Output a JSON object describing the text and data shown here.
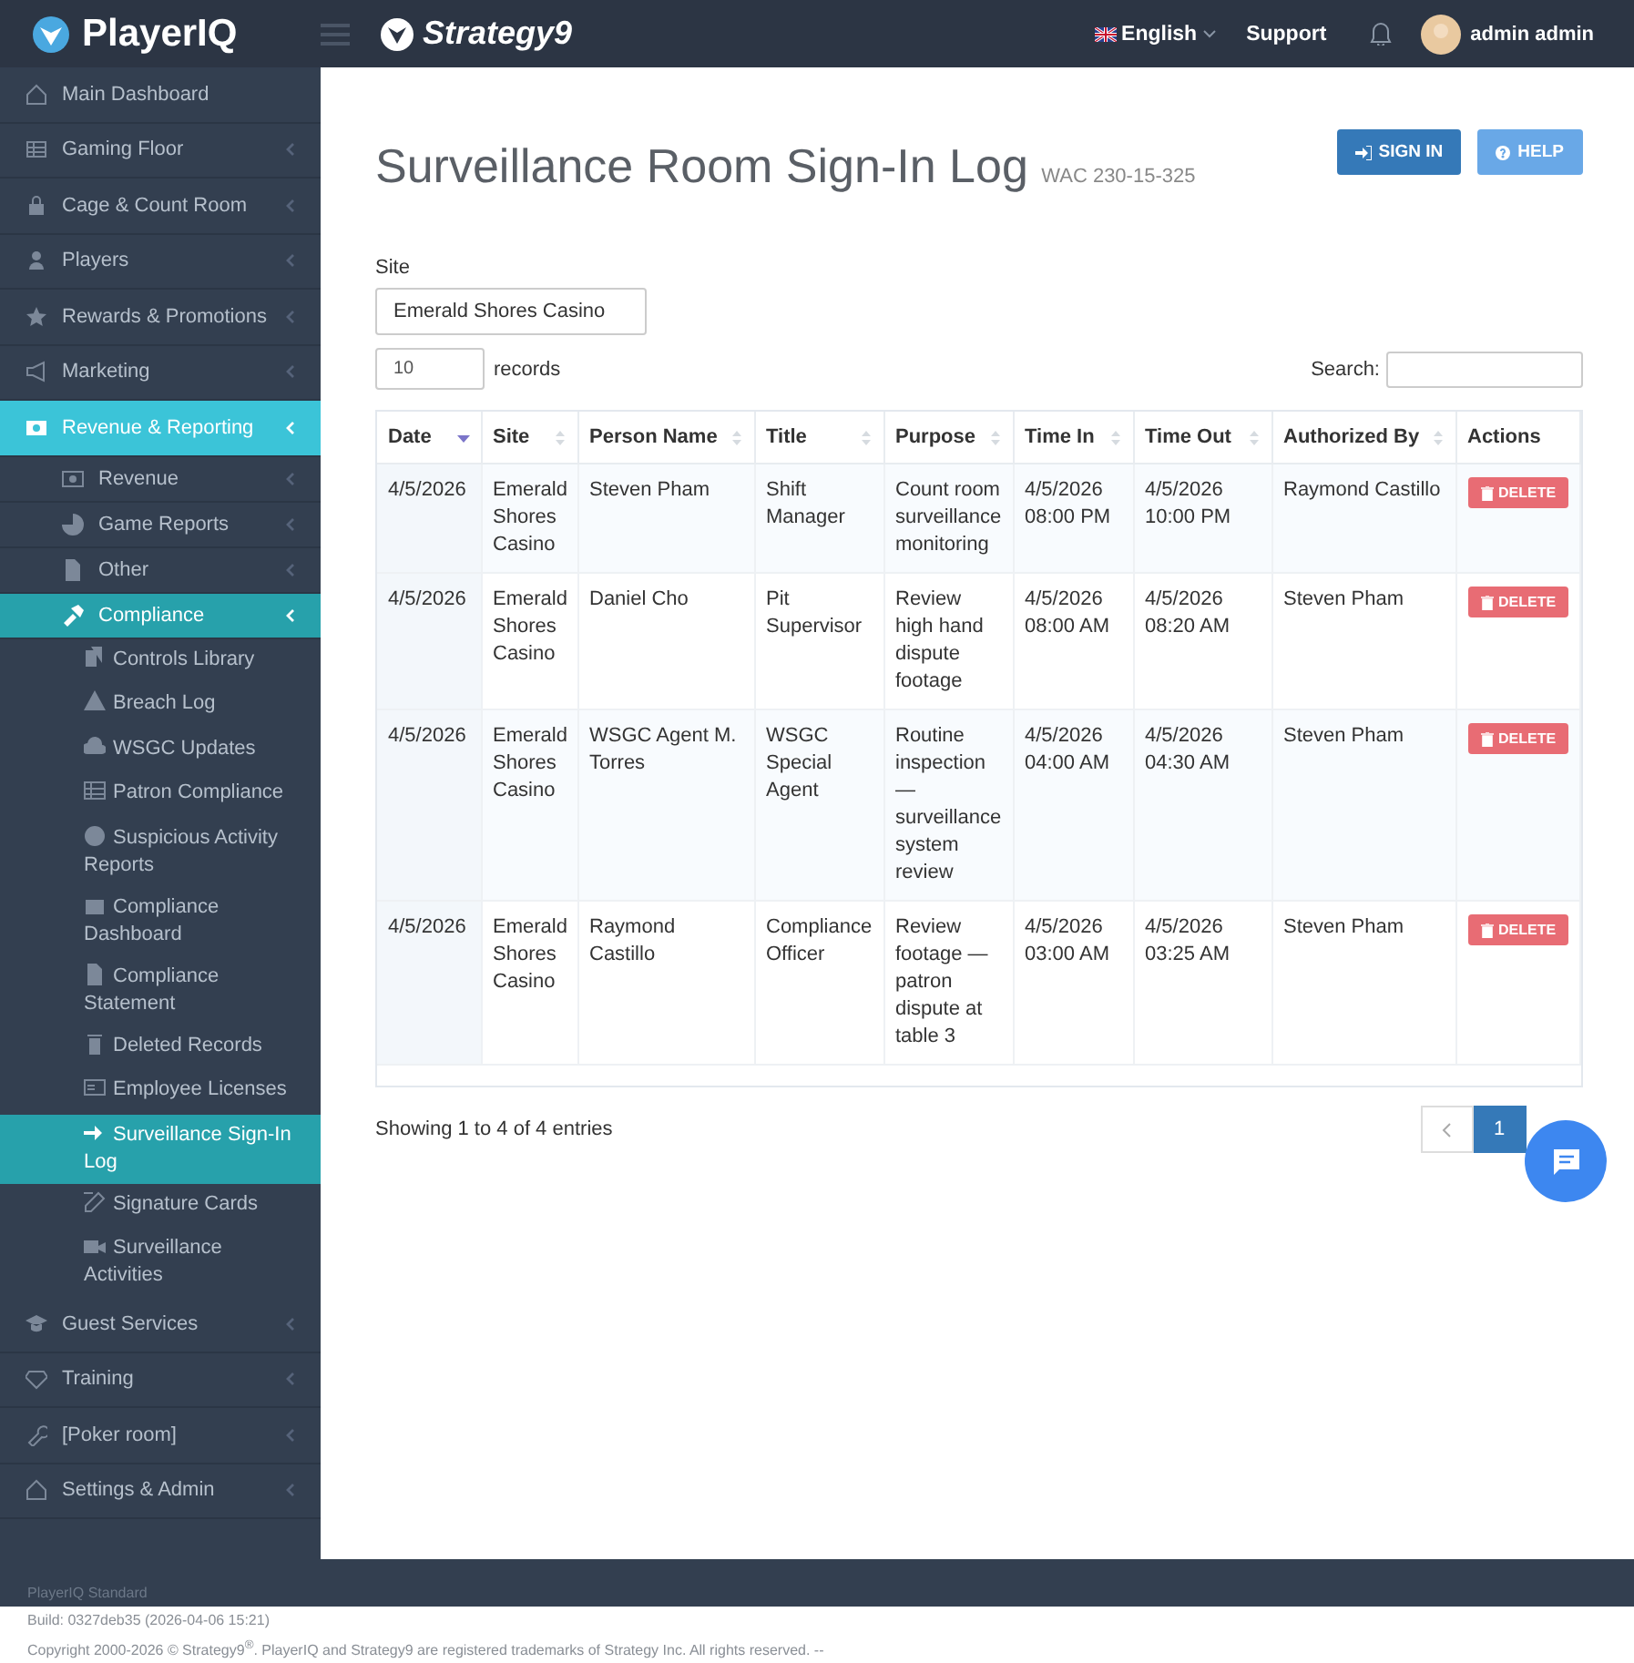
{
  "topbar": {
    "brand": "PlayerIQ",
    "company": "Strategy9",
    "language": "English",
    "support": "Support",
    "user": "admin admin"
  },
  "sidebar": {
    "items": [
      {
        "label": "Main Dashboard",
        "selected": false
      },
      {
        "label": "Gaming Floor",
        "selected": false,
        "expanded": false
      },
      {
        "label": "Cage & Count Room",
        "selected": false,
        "expanded": false
      },
      {
        "label": "Players",
        "selected": false,
        "expanded": false
      },
      {
        "label": "Rewards & Promotions",
        "selected": false,
        "expanded": false
      },
      {
        "label": "Marketing",
        "selected": false,
        "expanded": false
      },
      {
        "label": "Revenue & Reporting",
        "selected": true,
        "expanded": true,
        "children": [
          {
            "label": "Revenue",
            "selected": false,
            "expanded": false
          },
          {
            "label": "Game Reports",
            "selected": false,
            "expanded": false
          },
          {
            "label": "Other",
            "selected": false,
            "expanded": false
          },
          {
            "label": "Compliance",
            "selected": true,
            "expanded": true,
            "children": [
              {
                "label": "Controls Library",
                "selected": false
              },
              {
                "label": "Breach Log",
                "selected": false
              },
              {
                "label": "WSGC Updates",
                "selected": false
              },
              {
                "label": "Patron Compliance",
                "selected": false
              },
              {
                "label": "Suspicious Activity Reports",
                "selected": false
              },
              {
                "label": "Compliance Dashboard",
                "selected": false
              },
              {
                "label": "Compliance Statement",
                "selected": false
              },
              {
                "label": "Deleted Records",
                "selected": false
              },
              {
                "label": "Employee Licenses",
                "selected": false
              },
              {
                "label": "Surveillance Sign-In Log",
                "selected": true
              },
              {
                "label": "Signature Cards",
                "selected": false
              },
              {
                "label": "Surveillance Activities",
                "selected": false
              }
            ]
          }
        ]
      },
      {
        "label": "Guest Services",
        "selected": false,
        "expanded": false
      },
      {
        "label": "Training",
        "selected": false,
        "expanded": false
      },
      {
        "label": "[Poker room]",
        "selected": false,
        "expanded": false
      },
      {
        "label": "Settings & Admin",
        "selected": false,
        "expanded": false
      }
    ]
  },
  "page": {
    "title": "Surveillance Room Sign-In Log",
    "subtitle": "WAC 230-15-325",
    "buttons": [
      {
        "label": "SIGN IN",
        "kind": "primary"
      },
      {
        "label": "HELP",
        "kind": "help"
      }
    ],
    "site_label": "Site",
    "site_value": "Emerald Shores Casino",
    "page_length": "10",
    "records_label": "records",
    "search_label": "Search:"
  },
  "table": {
    "columns": [
      {
        "label": "Date",
        "sorted": true
      },
      {
        "label": "Site",
        "sorted": false
      },
      {
        "label": "Person Name",
        "sorted": false
      },
      {
        "label": "Title",
        "sorted": false
      },
      {
        "label": "Purpose",
        "sorted": false
      },
      {
        "label": "Time In",
        "sorted": false
      },
      {
        "label": "Time Out",
        "sorted": false
      },
      {
        "label": "Authorized By",
        "sorted": false
      },
      {
        "label": "Actions"
      }
    ],
    "rows": [
      {
        "cells": [
          "4/5/2026",
          "Emerald Shores Casino",
          "Steven Pham",
          "Shift Manager",
          "Count room surveillance monitoring",
          "4/5/2026 08:00 PM",
          "4/5/2026 10:00 PM",
          "Raymond Castillo"
        ],
        "action": "DELETE"
      },
      {
        "cells": [
          "4/5/2026",
          "Emerald Shores Casino",
          "Daniel Cho",
          "Pit Supervisor",
          "Review high hand dispute footage",
          "4/5/2026 08:00 AM",
          "4/5/2026 08:20 AM",
          "Steven Pham"
        ],
        "action": "DELETE"
      },
      {
        "cells": [
          "4/5/2026",
          "Emerald Shores Casino",
          "WSGC Agent M. Torres",
          "WSGC Special Agent",
          "Routine inspection — surveillance system review",
          "4/5/2026 04:00 AM",
          "4/5/2026 04:30 AM",
          "Steven Pham"
        ],
        "action": "DELETE"
      },
      {
        "cells": [
          "4/5/2026",
          "Emerald Shores Casino",
          "Raymond Castillo",
          "Compliance Officer",
          "Review footage — patron dispute at table 3",
          "4/5/2026 03:00 AM",
          "4/5/2026 03:25 AM",
          "Steven Pham"
        ],
        "action": "DELETE"
      }
    ],
    "info": "Showing 1 to 4 of 4 entries",
    "pages": [
      {
        "label": "1",
        "selected": true
      }
    ]
  },
  "footer": {
    "edition": "PlayerIQ Standard",
    "build": "Build: 0327deb35 (2026-04-06 15:21)",
    "copyright": "Copyright 2000-2026 © Strategy9$^{®}$. PlayerIQ and Strategy9 are registered trademarks of Strategy Inc. All rights reserved. --"
  }
}
